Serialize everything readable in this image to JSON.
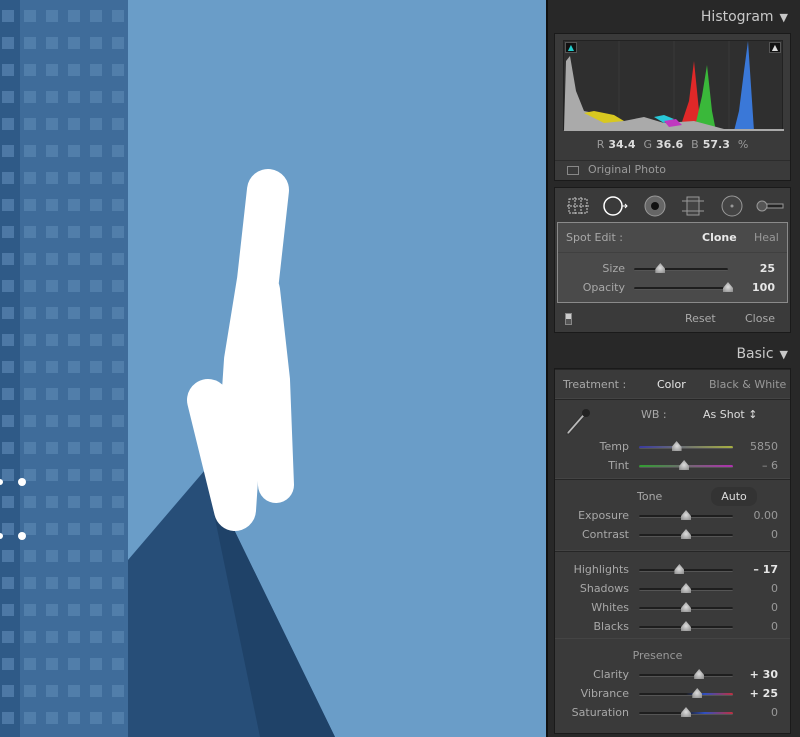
{
  "histogram": {
    "title": "Histogram",
    "r_label": "R",
    "r": "34.4",
    "g_label": "G",
    "g": "36.6",
    "b_label": "B",
    "b": "57.3",
    "pct": "%",
    "original_photo": "Original Photo"
  },
  "tools": [
    "crop-overlay",
    "spot-removal",
    "red-eye",
    "graduated-filter",
    "radial-filter",
    "adjustment-brush"
  ],
  "spot": {
    "label": "Spot Edit :",
    "clone": "Clone",
    "heal": "Heal",
    "size_label": "Size",
    "size": "25",
    "size_pos": 0.28,
    "opacity_label": "Opacity",
    "opacity": "100",
    "opacity_pos": 1.0,
    "reset": "Reset",
    "close": "Close"
  },
  "basic": {
    "title": "Basic",
    "treatment_label": "Treatment :",
    "color": "Color",
    "bw": "Black & White",
    "wb_label": "WB :",
    "wb_value": "As Shot ↕",
    "tone": "Tone",
    "auto": "Auto",
    "presence": "Presence",
    "wb_sliders": [
      {
        "label": "Temp",
        "value": "5850",
        "pos": 0.4,
        "grad": "linear-gradient(90deg,#3a3aa0,#a8b040)"
      },
      {
        "label": "Tint",
        "value": "– 6",
        "pos": 0.48,
        "grad": "linear-gradient(90deg,#30a030,#b030b0)"
      }
    ],
    "tone_sliders": [
      {
        "label": "Exposure",
        "value": "0.00",
        "pos": 0.5
      },
      {
        "label": "Contrast",
        "value": "0",
        "pos": 0.5
      }
    ],
    "hl_sliders": [
      {
        "label": "Highlights",
        "value": "– 17",
        "pos": 0.43,
        "hi": true
      },
      {
        "label": "Shadows",
        "value": "0",
        "pos": 0.5
      },
      {
        "label": "Whites",
        "value": "0",
        "pos": 0.5
      },
      {
        "label": "Blacks",
        "value": "0",
        "pos": 0.5
      }
    ],
    "presence_sliders": [
      {
        "label": "Clarity",
        "value": "+ 30",
        "pos": 0.64,
        "hi": true
      },
      {
        "label": "Vibrance",
        "value": "+ 25",
        "pos": 0.62,
        "hi": true,
        "grad": "linear-gradient(90deg,#1e1e1e 50%,#3050c0 70%,#c03040)"
      },
      {
        "label": "Saturation",
        "value": "0",
        "pos": 0.5,
        "grad": "linear-gradient(90deg,#1e1e1e 50%,#3050c0 70%,#c03040)"
      }
    ]
  }
}
